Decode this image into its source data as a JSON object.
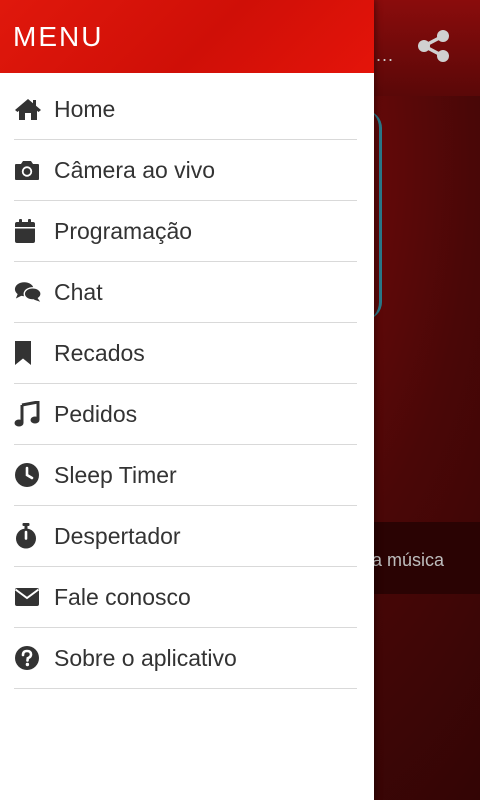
{
  "drawer": {
    "title": "MENU",
    "items": [
      {
        "label": "Home",
        "icon": "home-icon"
      },
      {
        "label": "Câmera ao vivo",
        "icon": "camera-icon"
      },
      {
        "label": "Programação",
        "icon": "calendar-icon"
      },
      {
        "label": "Chat",
        "icon": "chat-icon"
      },
      {
        "label": "Recados",
        "icon": "bookmark-icon"
      },
      {
        "label": "Pedidos",
        "icon": "music-icon"
      },
      {
        "label": "Sleep Timer",
        "icon": "clock-icon"
      },
      {
        "label": "Despertador",
        "icon": "stopwatch-icon"
      },
      {
        "label": "Fale conosco",
        "icon": "envelope-icon"
      },
      {
        "label": "Sobre o aplicativo",
        "icon": "question-circle-icon"
      }
    ]
  },
  "background": {
    "now_playing_fragment": "a música",
    "overflow_dots": "...",
    "share_icon": "share-icon"
  },
  "colors": {
    "header_red": "#e0180c",
    "icon_dark": "#333333",
    "divider": "#d9d9d9"
  }
}
